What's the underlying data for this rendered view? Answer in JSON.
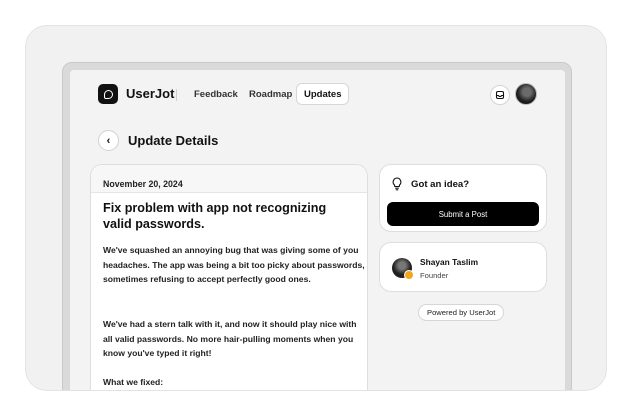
{
  "nav": {
    "brand": "UserJot",
    "links": {
      "feedback": "Feedback",
      "roadmap": "Roadmap",
      "updates": "Updates"
    },
    "icons": {
      "logo": "chat-bubble-icon",
      "notifications": "inbox-icon",
      "avatar": "user-avatar"
    }
  },
  "page": {
    "title": "Update Details"
  },
  "update": {
    "date": "November 20, 2024",
    "title": "Fix problem with app not recognizing valid passwords.",
    "paragraphs": [
      "We've squashed an annoying bug that was giving some of you headaches. The app was being a bit too picky about passwords, sometimes refusing to accept perfectly good ones.",
      "We've had a stern talk with it, and now it should play nice with all valid passwords. No more hair-pulling moments when you know you've typed it right!",
      "What we fixed:"
    ]
  },
  "idea": {
    "title": "Got an idea?",
    "button": "Submit a Post"
  },
  "author": {
    "name": "Shayan Taslim",
    "role": "Founder"
  },
  "footer": {
    "powered_by": "Powered by UserJot"
  },
  "colors": {
    "primary_button": "#000000",
    "badge": "#f3a61a",
    "background": "#f3f3f4"
  }
}
